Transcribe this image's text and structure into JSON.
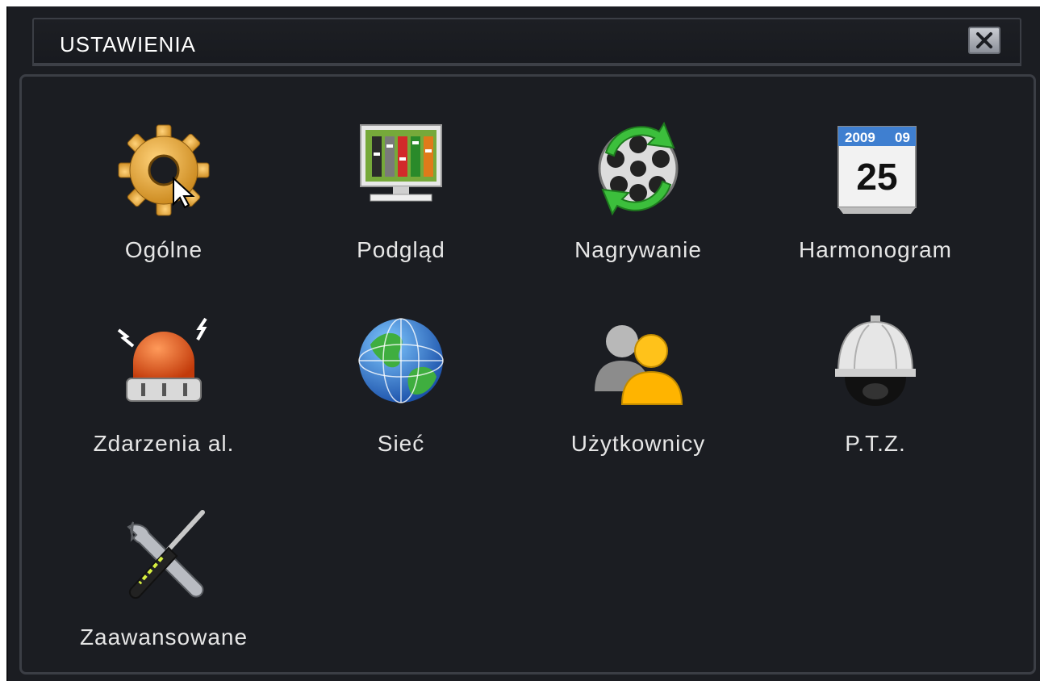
{
  "window": {
    "title": "USTAWIENIA",
    "close_icon": "close-icon"
  },
  "menu": [
    {
      "label": "Ogólne",
      "icon": "gear-icon"
    },
    {
      "label": "Podgląd",
      "icon": "monitor-icon"
    },
    {
      "label": "Nagrywanie",
      "icon": "film-reel-icon"
    },
    {
      "label": "Harmonogram",
      "icon": "calendar-icon",
      "calendar_year": "2009",
      "calendar_month": "09",
      "calendar_day": "25"
    },
    {
      "label": "Zdarzenia al.",
      "icon": "alarm-siren-icon"
    },
    {
      "label": "Sieć",
      "icon": "globe-icon"
    },
    {
      "label": "Użytkownicy",
      "icon": "users-icon"
    },
    {
      "label": "P.T.Z.",
      "icon": "dome-camera-icon"
    },
    {
      "label": "Zaawansowane",
      "icon": "tools-icon"
    }
  ],
  "colors": {
    "background": "#1b1d22",
    "border": "#3b3e45",
    "text": "#e6e6e6"
  }
}
